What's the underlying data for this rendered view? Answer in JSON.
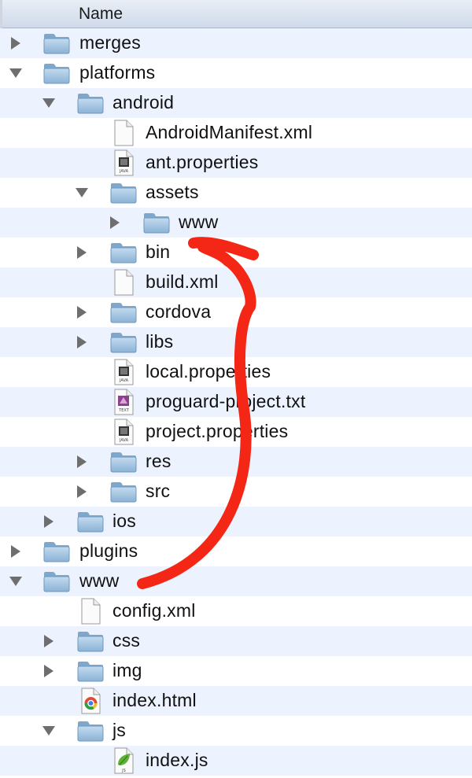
{
  "header": {
    "column_name": "Name"
  },
  "rows": [
    {
      "label": "merges",
      "kind": "folder",
      "expanded": false,
      "depth": 0
    },
    {
      "label": "platforms",
      "kind": "folder",
      "expanded": true,
      "depth": 0
    },
    {
      "label": "android",
      "kind": "folder",
      "expanded": true,
      "depth": 1
    },
    {
      "label": "AndroidManifest.xml",
      "kind": "file-blank",
      "depth": 2
    },
    {
      "label": "ant.properties",
      "kind": "file-java",
      "depth": 2
    },
    {
      "label": "assets",
      "kind": "folder",
      "expanded": true,
      "depth": 2
    },
    {
      "label": "www",
      "kind": "folder",
      "expanded": false,
      "depth": 3
    },
    {
      "label": "bin",
      "kind": "folder",
      "expanded": false,
      "depth": 2
    },
    {
      "label": "build.xml",
      "kind": "file-blank",
      "depth": 2
    },
    {
      "label": "cordova",
      "kind": "folder",
      "expanded": false,
      "depth": 2
    },
    {
      "label": "libs",
      "kind": "folder",
      "expanded": false,
      "depth": 2
    },
    {
      "label": "local.properties",
      "kind": "file-java",
      "depth": 2
    },
    {
      "label": "proguard-project.txt",
      "kind": "file-text",
      "depth": 2
    },
    {
      "label": "project.properties",
      "kind": "file-java",
      "depth": 2
    },
    {
      "label": "res",
      "kind": "folder",
      "expanded": false,
      "depth": 2
    },
    {
      "label": "src",
      "kind": "folder",
      "expanded": false,
      "depth": 2
    },
    {
      "label": "ios",
      "kind": "folder",
      "expanded": false,
      "depth": 1
    },
    {
      "label": "plugins",
      "kind": "folder",
      "expanded": false,
      "depth": 0
    },
    {
      "label": "www",
      "kind": "folder",
      "expanded": true,
      "depth": 0
    },
    {
      "label": "config.xml",
      "kind": "file-blank",
      "depth": 1
    },
    {
      "label": "css",
      "kind": "folder",
      "expanded": false,
      "depth": 1
    },
    {
      "label": "img",
      "kind": "folder",
      "expanded": false,
      "depth": 1
    },
    {
      "label": "index.html",
      "kind": "file-chrome",
      "depth": 1
    },
    {
      "label": "js",
      "kind": "folder",
      "expanded": true,
      "depth": 1
    },
    {
      "label": "index.js",
      "kind": "file-js",
      "depth": 2
    }
  ],
  "annotation": {
    "arrow_color": "#f42616",
    "from": "www",
    "to": "platforms/android/assets/www"
  },
  "icon_badges": {
    "java": "JAVA",
    "text": "TEXT",
    "js": "JS"
  },
  "colors": {
    "row_alt": "#edf3fe",
    "folder_top": "#b9d3ea",
    "folder_bottom": "#86aed3"
  }
}
